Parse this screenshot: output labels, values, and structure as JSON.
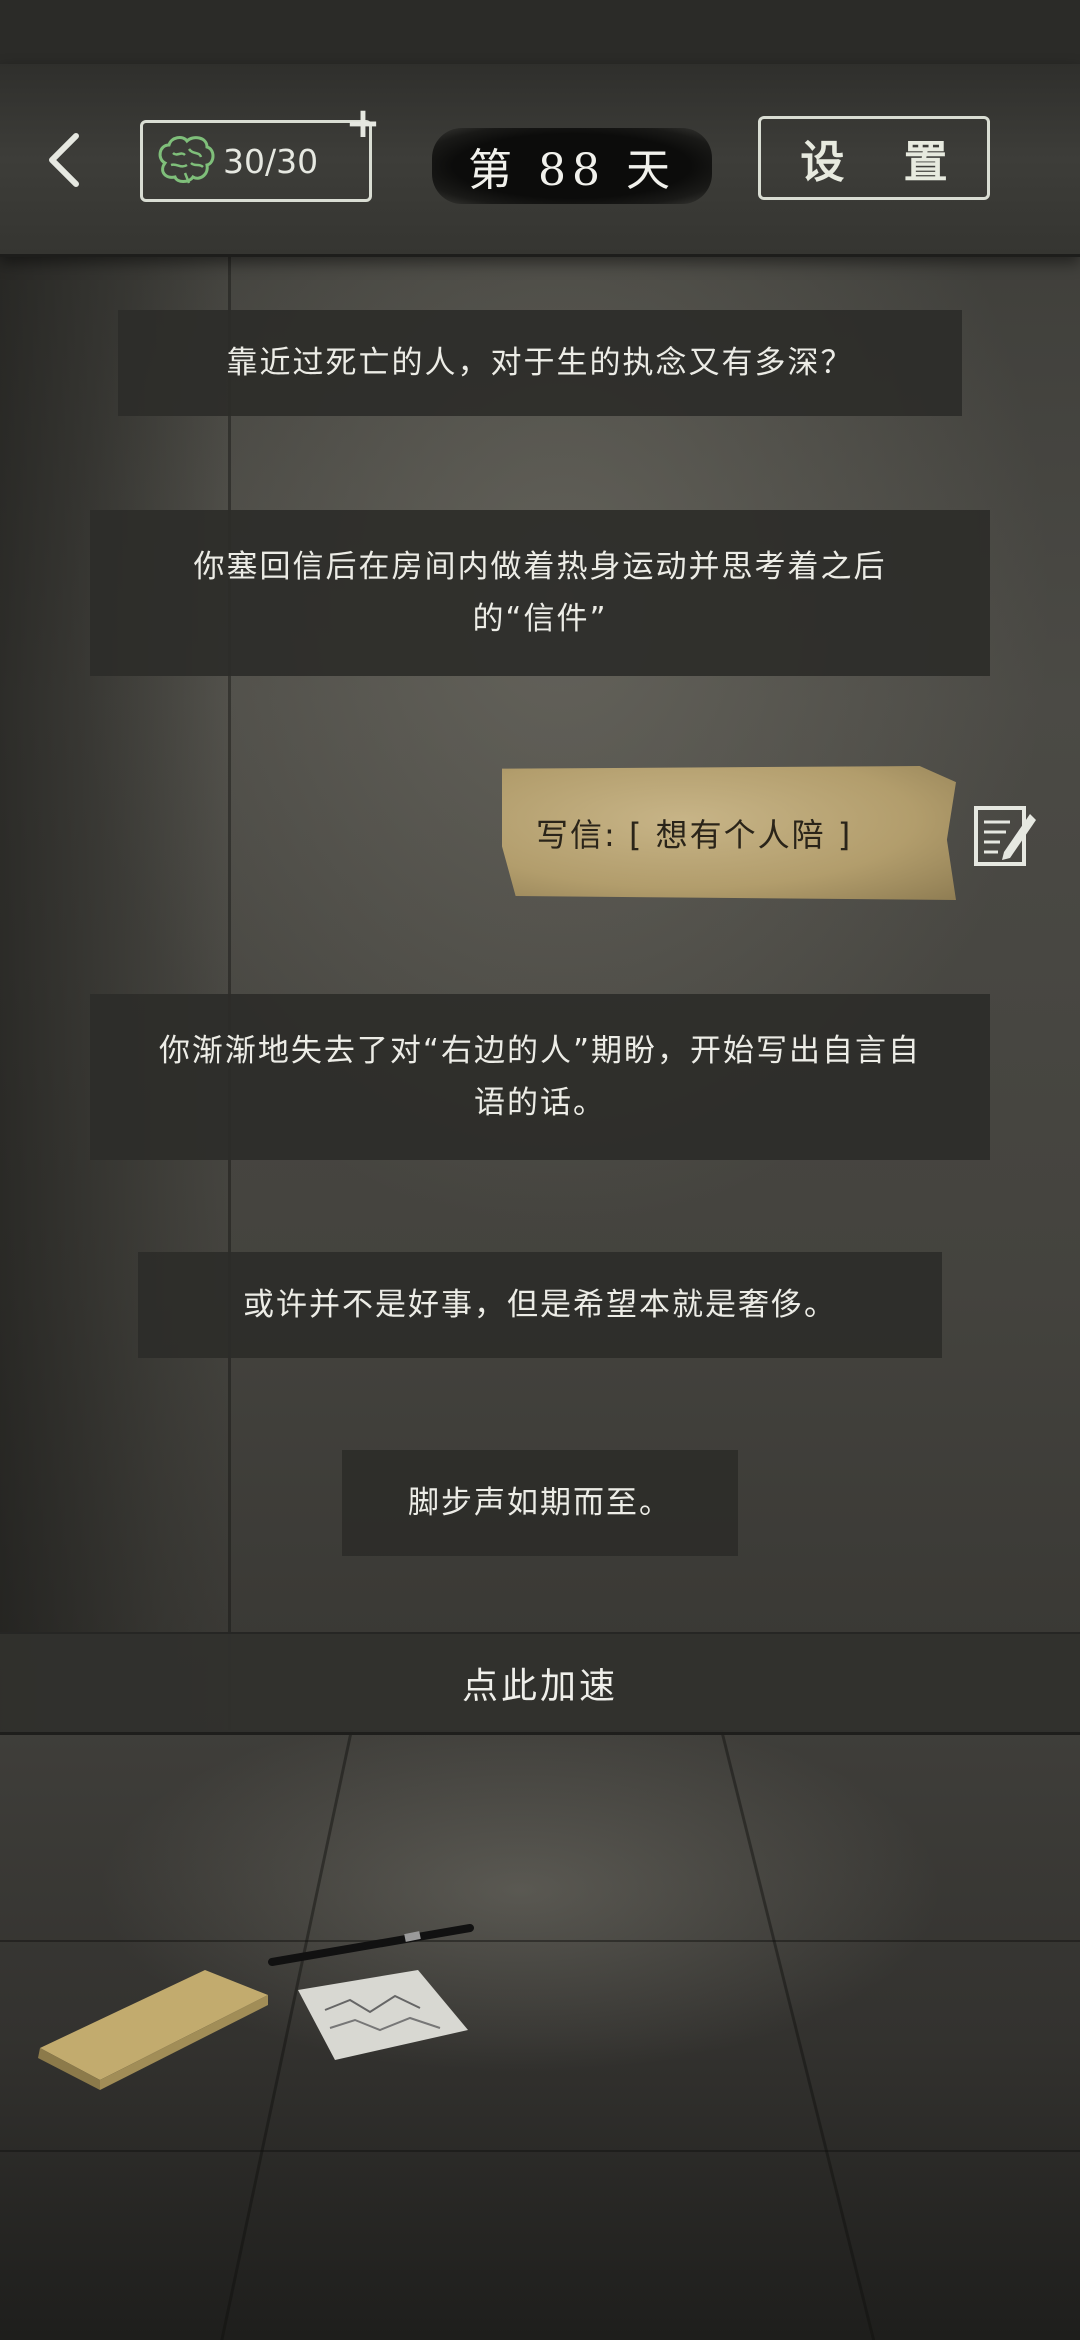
{
  "header": {
    "back_icon": "chevron-left-icon",
    "brain_icon": "brain-icon",
    "energy": "30/30",
    "plus": "+",
    "day": "第 88 天",
    "settings_label": "设 置"
  },
  "messages": [
    "靠近过死亡的人，对于生的执念又有多深？",
    "你塞回信后在房间内做着热身运动并思考着之后的“信件”",
    "你渐渐地失去了对“右边的人”期盼，开始写出自言自语的话。",
    "或许并不是好事，但是希望本就是奢侈。",
    "脚步声如期而至。"
  ],
  "letter": {
    "label": "写信: [ 想有个人陪 ]",
    "icon": "write-letter-icon"
  },
  "speed_up_label": "点此加速",
  "colors": {
    "accent": "#d9ddd3",
    "brain": "#7fbf7a",
    "paper": "#b8a271"
  }
}
